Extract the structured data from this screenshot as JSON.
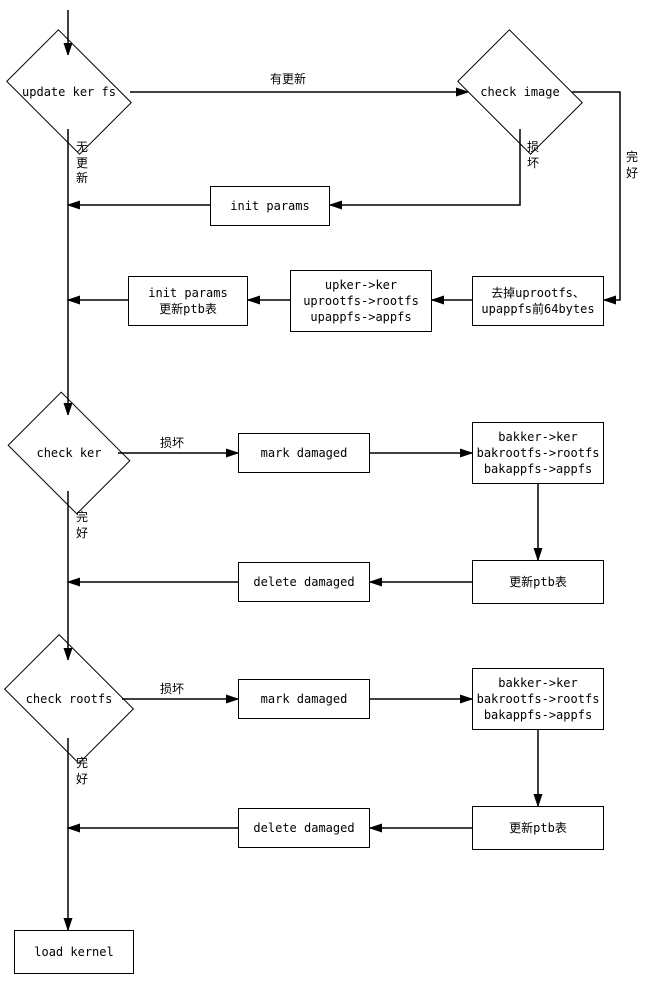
{
  "nodes": {
    "update_ker_fs": "update ker fs",
    "check_image": "check image",
    "init_params": "init params",
    "strip_64": "去掉uprootfs、\nupappfs前64bytes",
    "copy_up": "upker->ker\nuprootfs->rootfs\nupappfs->appfs",
    "init_params_ptb": "init params\n更新ptb表",
    "check_ker": "check ker",
    "mark_damaged1": "mark damaged",
    "bak_copy1": "bakker->ker\nbakrootfs->rootfs\nbakappfs->appfs",
    "update_ptb1": "更新ptb表",
    "delete_damaged1": "delete damaged",
    "check_rootfs": "check rootfs",
    "mark_damaged2": "mark damaged",
    "bak_copy2": "bakker->ker\nbakrootfs->rootfs\nbakappfs->appfs",
    "update_ptb2": "更新ptb表",
    "delete_damaged2": "delete damaged",
    "load_kernel": "load kernel"
  },
  "edges": {
    "has_update": "有更新",
    "no_update": "无\n更\n新",
    "damaged": "损\n坏",
    "ok_right": "完\n好",
    "damaged_h": "损坏",
    "ok_down": "完\n好"
  }
}
